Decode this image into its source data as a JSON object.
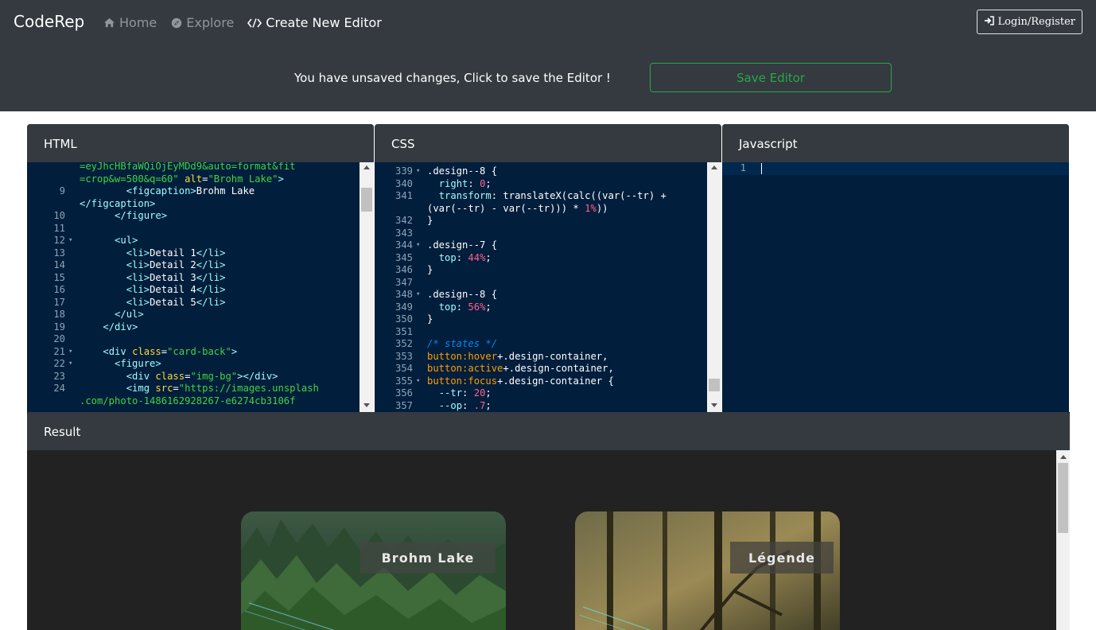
{
  "navbar": {
    "brand": "CodeRep",
    "items": [
      {
        "label": "Home",
        "icon": "home-icon",
        "active": false
      },
      {
        "label": "Explore",
        "icon": "compass-icon",
        "active": false
      },
      {
        "label": "Create New Editor",
        "icon": "code-icon",
        "active": true
      }
    ],
    "login_label": "Login/Register"
  },
  "notice": {
    "text": "You have unsaved changes, Click to save the Editor !",
    "save_label": "Save Editor"
  },
  "panels": {
    "html_title": "HTML",
    "css_title": "CSS",
    "js_title": "Javascript",
    "result_title": "Result"
  },
  "html_editor": {
    "lines": [
      {
        "num": "",
        "fold": false,
        "tokens": [
          [
            "s",
            "=eyJhcHBfaWQiOjEyMDd9&auto=format&fit"
          ]
        ]
      },
      {
        "num": "",
        "fold": false,
        "tokens": [
          [
            "s",
            "=crop&w=500&q=60\""
          ],
          [
            "t",
            " "
          ],
          [
            "a",
            "alt"
          ],
          [
            "t",
            "="
          ],
          [
            "s",
            "\"Brohm Lake\""
          ],
          [
            "g",
            ">"
          ]
        ]
      },
      {
        "num": "9",
        "fold": false,
        "tokens": [
          [
            "t",
            "        "
          ],
          [
            "g",
            "<figcaption>"
          ],
          [
            "t",
            "Brohm Lake"
          ]
        ]
      },
      {
        "num": "",
        "fold": false,
        "tokens": [
          [
            "g",
            "</figcaption>"
          ]
        ]
      },
      {
        "num": "10",
        "fold": false,
        "tokens": [
          [
            "t",
            "      "
          ],
          [
            "g",
            "</figure>"
          ]
        ]
      },
      {
        "num": "11",
        "fold": false,
        "tokens": [
          [
            "t",
            ""
          ]
        ]
      },
      {
        "num": "12",
        "fold": true,
        "tokens": [
          [
            "t",
            "      "
          ],
          [
            "g",
            "<ul>"
          ]
        ]
      },
      {
        "num": "13",
        "fold": false,
        "tokens": [
          [
            "t",
            "        "
          ],
          [
            "g",
            "<li>"
          ],
          [
            "t",
            "Detail 1"
          ],
          [
            "g",
            "</li>"
          ]
        ]
      },
      {
        "num": "14",
        "fold": false,
        "tokens": [
          [
            "t",
            "        "
          ],
          [
            "g",
            "<li>"
          ],
          [
            "t",
            "Detail 2"
          ],
          [
            "g",
            "</li>"
          ]
        ]
      },
      {
        "num": "15",
        "fold": false,
        "tokens": [
          [
            "t",
            "        "
          ],
          [
            "g",
            "<li>"
          ],
          [
            "t",
            "Detail 3"
          ],
          [
            "g",
            "</li>"
          ]
        ]
      },
      {
        "num": "16",
        "fold": false,
        "tokens": [
          [
            "t",
            "        "
          ],
          [
            "g",
            "<li>"
          ],
          [
            "t",
            "Detail 4"
          ],
          [
            "g",
            "</li>"
          ]
        ]
      },
      {
        "num": "17",
        "fold": false,
        "tokens": [
          [
            "t",
            "        "
          ],
          [
            "g",
            "<li>"
          ],
          [
            "t",
            "Detail 5"
          ],
          [
            "g",
            "</li>"
          ]
        ]
      },
      {
        "num": "18",
        "fold": false,
        "tokens": [
          [
            "t",
            "      "
          ],
          [
            "g",
            "</ul>"
          ]
        ]
      },
      {
        "num": "19",
        "fold": false,
        "tokens": [
          [
            "t",
            "    "
          ],
          [
            "g",
            "</div>"
          ]
        ]
      },
      {
        "num": "20",
        "fold": false,
        "tokens": [
          [
            "t",
            ""
          ]
        ]
      },
      {
        "num": "21",
        "fold": true,
        "tokens": [
          [
            "t",
            "    "
          ],
          [
            "g",
            "<div"
          ],
          [
            "t",
            " "
          ],
          [
            "a",
            "class"
          ],
          [
            "t",
            "="
          ],
          [
            "s",
            "\"card-back\""
          ],
          [
            "g",
            ">"
          ]
        ]
      },
      {
        "num": "22",
        "fold": true,
        "tokens": [
          [
            "t",
            "      "
          ],
          [
            "g",
            "<figure>"
          ]
        ]
      },
      {
        "num": "23",
        "fold": false,
        "tokens": [
          [
            "t",
            "        "
          ],
          [
            "g",
            "<div"
          ],
          [
            "t",
            " "
          ],
          [
            "a",
            "class"
          ],
          [
            "t",
            "="
          ],
          [
            "s",
            "\"img-bg\""
          ],
          [
            "g",
            "></div>"
          ]
        ]
      },
      {
        "num": "24",
        "fold": false,
        "tokens": [
          [
            "t",
            "        "
          ],
          [
            "g",
            "<img"
          ],
          [
            "t",
            " "
          ],
          [
            "a",
            "src"
          ],
          [
            "t",
            "="
          ],
          [
            "s",
            "\"https://images.unsplash"
          ]
        ]
      },
      {
        "num": "",
        "fold": false,
        "tokens": [
          [
            "s",
            ".com/photo-1486162928267-e6274cb3106f"
          ]
        ]
      }
    ]
  },
  "css_editor": {
    "lines": [
      {
        "num": "339",
        "fold": true,
        "tokens": [
          [
            "t",
            ".design--8 {"
          ]
        ]
      },
      {
        "num": "340",
        "fold": false,
        "tokens": [
          [
            "t",
            "  "
          ],
          [
            "p",
            "right"
          ],
          [
            "t",
            ": "
          ],
          [
            "n",
            "0"
          ],
          [
            "t",
            ";"
          ]
        ]
      },
      {
        "num": "341",
        "fold": false,
        "tokens": [
          [
            "t",
            "  "
          ],
          [
            "p",
            "transform"
          ],
          [
            "t",
            ": translateX(calc((var(--tr) +"
          ]
        ]
      },
      {
        "num": "",
        "fold": false,
        "tokens": [
          [
            "t",
            "(var(--tr) - var(--tr))) * "
          ],
          [
            "n",
            "1%"
          ],
          [
            "t",
            "))"
          ]
        ]
      },
      {
        "num": "342",
        "fold": false,
        "tokens": [
          [
            "t",
            "}"
          ]
        ]
      },
      {
        "num": "343",
        "fold": false,
        "tokens": [
          [
            "t",
            ""
          ]
        ]
      },
      {
        "num": "344",
        "fold": true,
        "tokens": [
          [
            "t",
            ".design--7 {"
          ]
        ]
      },
      {
        "num": "345",
        "fold": false,
        "tokens": [
          [
            "t",
            "  "
          ],
          [
            "p",
            "top"
          ],
          [
            "t",
            ": "
          ],
          [
            "n",
            "44%"
          ],
          [
            "t",
            ";"
          ]
        ]
      },
      {
        "num": "346",
        "fold": false,
        "tokens": [
          [
            "t",
            "}"
          ]
        ]
      },
      {
        "num": "347",
        "fold": false,
        "tokens": [
          [
            "t",
            ""
          ]
        ]
      },
      {
        "num": "348",
        "fold": true,
        "tokens": [
          [
            "t",
            ".design--8 {"
          ]
        ]
      },
      {
        "num": "349",
        "fold": false,
        "tokens": [
          [
            "t",
            "  "
          ],
          [
            "p",
            "top"
          ],
          [
            "t",
            ": "
          ],
          [
            "n",
            "56%"
          ],
          [
            "t",
            ";"
          ]
        ]
      },
      {
        "num": "350",
        "fold": false,
        "tokens": [
          [
            "t",
            "}"
          ]
        ]
      },
      {
        "num": "351",
        "fold": false,
        "tokens": [
          [
            "t",
            ""
          ]
        ]
      },
      {
        "num": "352",
        "fold": false,
        "tokens": [
          [
            "c",
            "/* states */"
          ]
        ]
      },
      {
        "num": "353",
        "fold": false,
        "tokens": [
          [
            "r",
            "button:hover"
          ],
          [
            "t",
            "+.design-container,"
          ]
        ]
      },
      {
        "num": "354",
        "fold": false,
        "tokens": [
          [
            "r",
            "button:active"
          ],
          [
            "t",
            "+.design-container,"
          ]
        ]
      },
      {
        "num": "355",
        "fold": true,
        "tokens": [
          [
            "r",
            "button:focus"
          ],
          [
            "t",
            "+.design-container {"
          ]
        ]
      },
      {
        "num": "356",
        "fold": false,
        "tokens": [
          [
            "t",
            "  "
          ],
          [
            "p",
            "--tr"
          ],
          [
            "t",
            ": "
          ],
          [
            "n",
            "20"
          ],
          [
            "t",
            ";"
          ]
        ]
      },
      {
        "num": "357",
        "fold": false,
        "tokens": [
          [
            "t",
            "  "
          ],
          [
            "p",
            "--op"
          ],
          [
            "t",
            ": "
          ],
          [
            "n",
            ".7"
          ],
          [
            "t",
            ";"
          ]
        ]
      }
    ]
  },
  "js_editor": {
    "lines": [
      {
        "num": "1"
      }
    ]
  },
  "result": {
    "cards": [
      {
        "caption": "Brohm  Lake"
      },
      {
        "caption": "Légende"
      }
    ]
  }
}
